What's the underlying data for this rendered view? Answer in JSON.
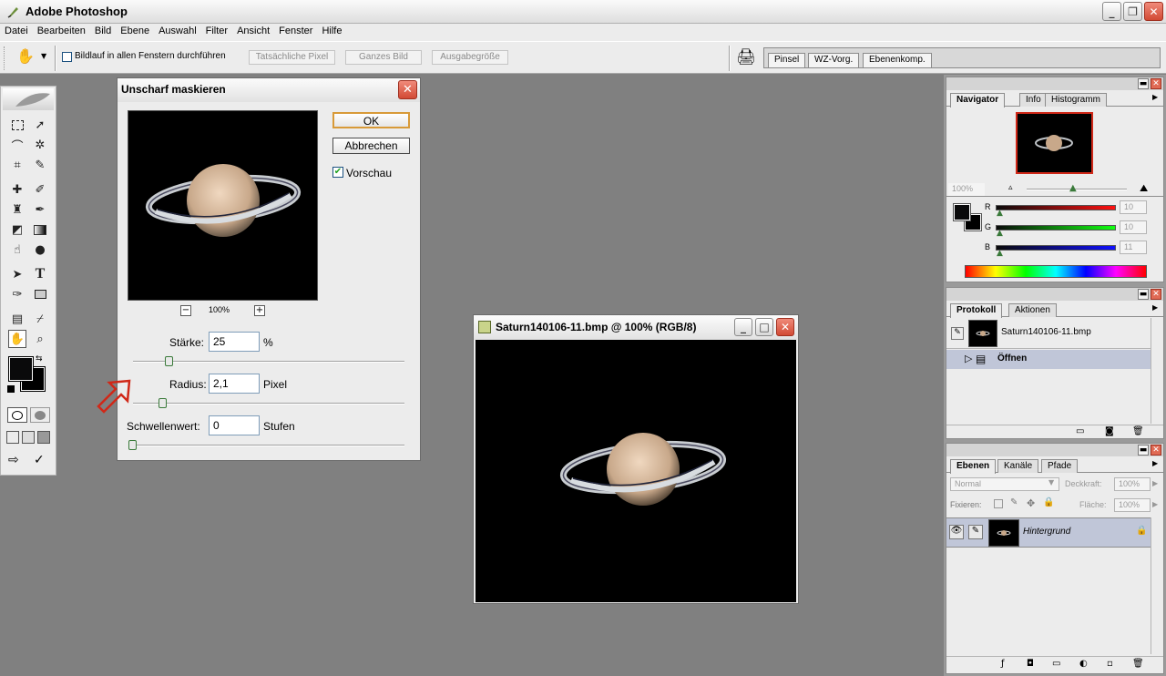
{
  "app": {
    "title": "Adobe Photoshop"
  },
  "menu": [
    "Datei",
    "Bearbeiten",
    "Bild",
    "Ebene",
    "Auswahl",
    "Filter",
    "Ansicht",
    "Fenster",
    "Hilfe"
  ],
  "options": {
    "scroll_all_label": "Bildlauf in allen Fenstern durchführen",
    "actual_pixels": "Tatsächliche Pixel",
    "fit_screen": "Ganzes Bild",
    "print_size": "Ausgabegröße"
  },
  "palette_well": [
    "Pinsel",
    "WZ-Vorg.",
    "Ebenenkomp."
  ],
  "dialog": {
    "title": "Unscharf maskieren",
    "ok": "OK",
    "cancel": "Abbrechen",
    "preview_label": "Vorschau",
    "preview_checked": true,
    "zoom": "100%",
    "amount_label": "Stärke:",
    "amount_value": "25",
    "amount_unit": "%",
    "radius_label": "Radius:",
    "radius_value": "2,1",
    "radius_unit": "Pixel",
    "threshold_label": "Schwellenwert:",
    "threshold_value": "0",
    "threshold_unit": "Stufen"
  },
  "document": {
    "title": "Saturn140106-11.bmp @ 100% (RGB/8)"
  },
  "navigator": {
    "tabs": [
      "Navigator",
      "Info",
      "Histogramm"
    ],
    "zoom": "100%"
  },
  "color": {
    "r_label": "R",
    "r_value": "10",
    "g_label": "G",
    "g_value": "10",
    "b_label": "B",
    "b_value": "11"
  },
  "history": {
    "tabs": [
      "Protokoll",
      "Aktionen"
    ],
    "snapshot": "Saturn140106-11.bmp",
    "step": "Öffnen"
  },
  "layers": {
    "tabs": [
      "Ebenen",
      "Kanäle",
      "Pfade"
    ],
    "blend_mode": "Normal",
    "opacity_label": "Deckkraft:",
    "opacity_value": "100%",
    "lock_label": "Fixieren:",
    "fill_label": "Fläche:",
    "fill_value": "100%",
    "layer_name": "Hintergrund"
  },
  "colors": {
    "accent_red": "#d02818",
    "highlight": "#c0c6d8"
  }
}
